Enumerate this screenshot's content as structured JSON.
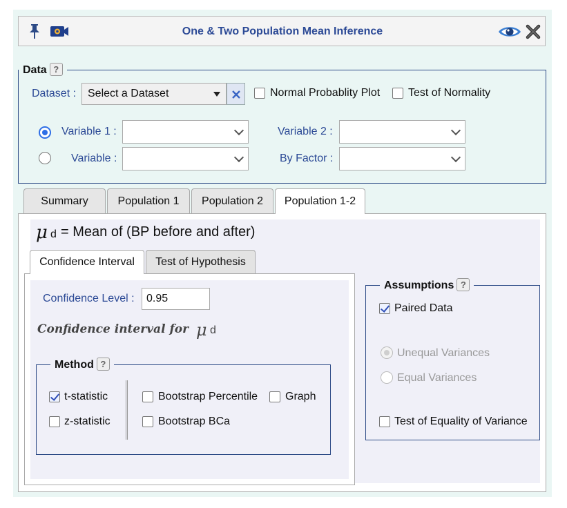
{
  "window": {
    "title": "One & Two Population Mean Inference"
  },
  "icons": {
    "pin": "pin-icon",
    "camera": "video-camera-icon",
    "eye": "eye-icon",
    "close": "close-icon"
  },
  "data_section": {
    "legend": "Data",
    "help": "?",
    "dataset_label": "Dataset :",
    "dataset_value": "Select a Dataset",
    "normal_plot_label": "Normal Probablity Plot",
    "normality_test_label": "Test of Normality",
    "variable1_label": "Variable 1 :",
    "variable2_label": "Variable 2 :",
    "variable_label": "Variable :",
    "by_factor_label": "By Factor :"
  },
  "tabs": [
    {
      "label": "Summary"
    },
    {
      "label": "Population 1"
    },
    {
      "label": "Population 2"
    },
    {
      "label": "Population 1-2"
    }
  ],
  "panel": {
    "mu_symbol": "μ",
    "mu_sub": "d",
    "mean_text": "= Mean of (BP before and after)",
    "subtabs": [
      {
        "label": "Confidence Interval"
      },
      {
        "label": "Test of Hypothesis"
      }
    ],
    "confidence_level_label": "Confidence Level :",
    "confidence_level_value": "0.95",
    "ci_heading": "Confidence interval for",
    "method": {
      "legend": "Method",
      "help": "?",
      "t_statistic": "t-statistic",
      "z_statistic": "z-statistic",
      "bootstrap_percentile": "Bootstrap Percentile",
      "bootstrap_bca": "Bootstrap BCa",
      "graph": "Graph"
    },
    "assumptions": {
      "legend": "Assumptions",
      "help": "?",
      "paired": "Paired Data",
      "unequal": "Unequal Variances",
      "equal": "Equal Variances",
      "equality_test": "Test of Equality of Variance"
    }
  },
  "colors": {
    "title_blue": "#2c4a96",
    "background": "#eaf6f4",
    "panel": "#f0f0f8"
  }
}
